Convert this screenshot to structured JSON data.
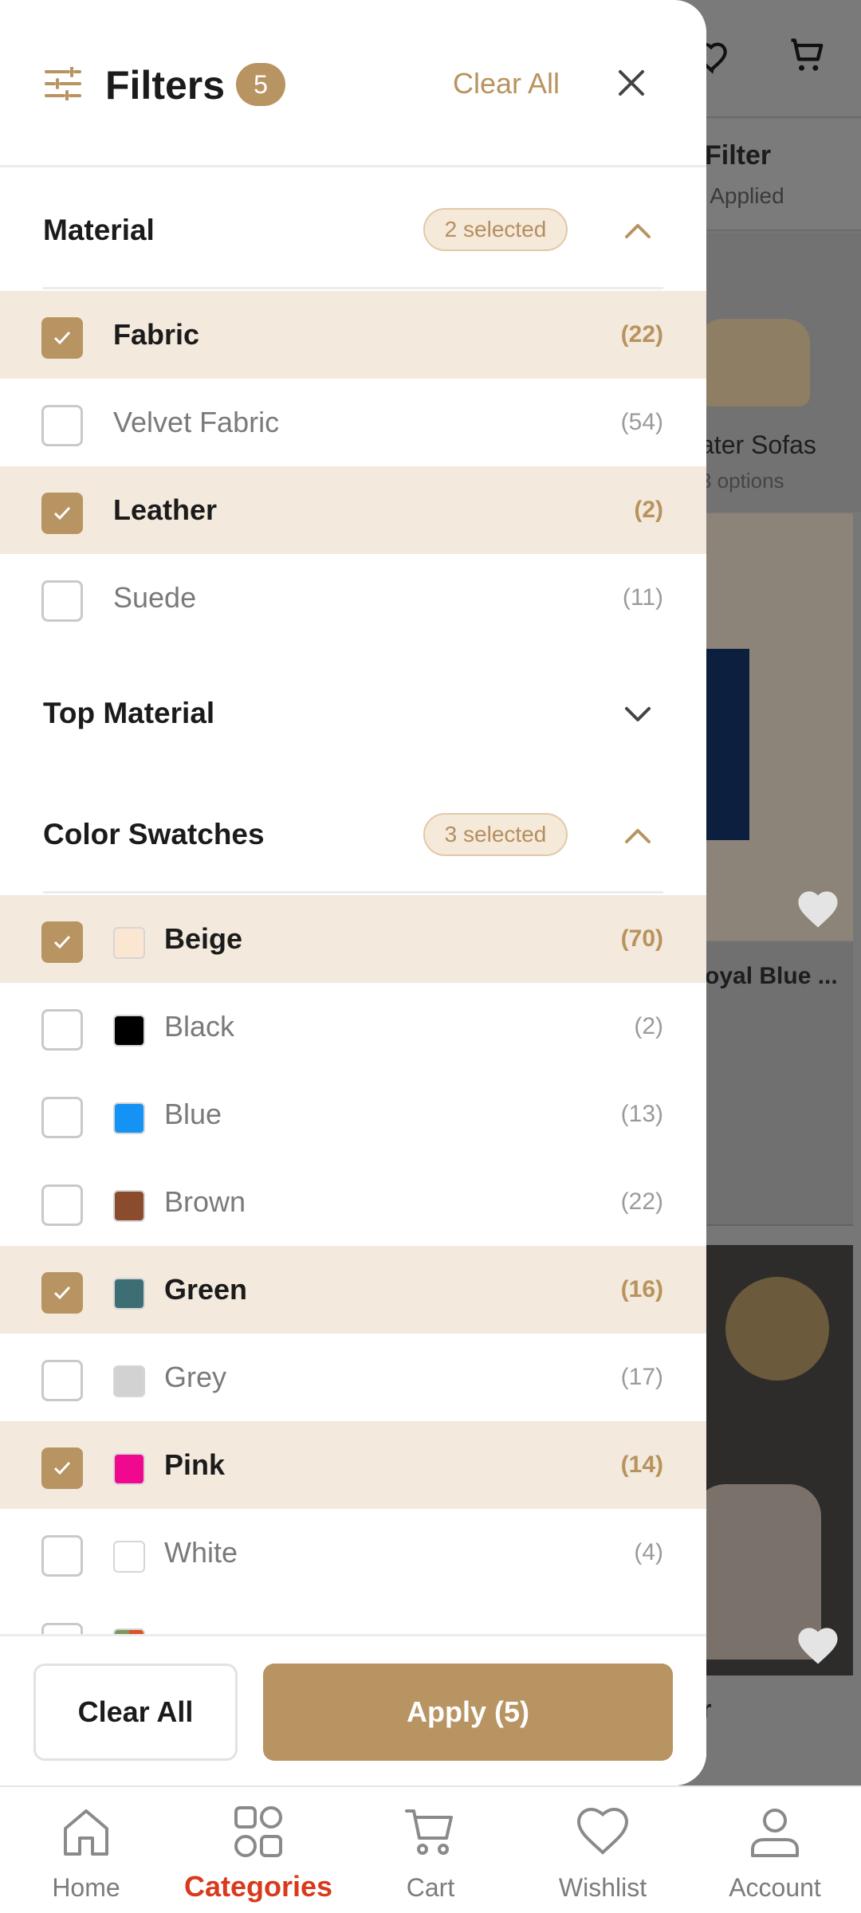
{
  "background": {
    "filter_title": "Filter",
    "filter_sub": "s Applied",
    "category_name": "ater Sofas",
    "category_sub": "3 options",
    "product1_name": "oyal Blue ...",
    "product2_name": "r"
  },
  "header": {
    "title": "Filters",
    "badge": "5",
    "clear_all": "Clear All"
  },
  "material": {
    "title": "Material",
    "selected": "2 selected",
    "items": [
      {
        "label": "Fabric",
        "count": "(22)",
        "checked": true
      },
      {
        "label": "Velvet Fabric",
        "count": "(54)",
        "checked": false
      },
      {
        "label": "Leather",
        "count": "(2)",
        "checked": true
      },
      {
        "label": "Suede",
        "count": "(11)",
        "checked": false
      }
    ]
  },
  "top_material": {
    "title": "Top Material"
  },
  "colors": {
    "title": "Color Swatches",
    "selected": "3 selected",
    "items": [
      {
        "label": "Beige",
        "count": "(70)",
        "checked": true,
        "swatch": "#fbe6d1"
      },
      {
        "label": "Black",
        "count": "(2)",
        "checked": false,
        "swatch": "#000000"
      },
      {
        "label": "Blue",
        "count": "(13)",
        "checked": false,
        "swatch": "#1493f4"
      },
      {
        "label": "Brown",
        "count": "(22)",
        "checked": false,
        "swatch": "#8b4c2e"
      },
      {
        "label": "Green",
        "count": "(16)",
        "checked": true,
        "swatch": "#3d6e74"
      },
      {
        "label": "Grey",
        "count": "(17)",
        "checked": false,
        "swatch": "#d2d2d2"
      },
      {
        "label": "Pink",
        "count": "(14)",
        "checked": true,
        "swatch": "#f0088e"
      },
      {
        "label": "White",
        "count": "(4)",
        "checked": false,
        "swatch": "#ffffff"
      }
    ]
  },
  "footer": {
    "clear_all": "Clear All",
    "apply": "Apply (5)"
  },
  "nav": {
    "items": [
      {
        "label": "Home",
        "icon": "home-icon"
      },
      {
        "label": "Categories",
        "icon": "categories-icon"
      },
      {
        "label": "Cart",
        "icon": "cart-icon"
      },
      {
        "label": "Wishlist",
        "icon": "heart-icon"
      },
      {
        "label": "Account",
        "icon": "account-icon"
      }
    ],
    "active": "Categories"
  },
  "colors_theme": {
    "accent": "#b89462",
    "accent_light": "#f3e9dd",
    "nav_active": "#d83a1c"
  }
}
